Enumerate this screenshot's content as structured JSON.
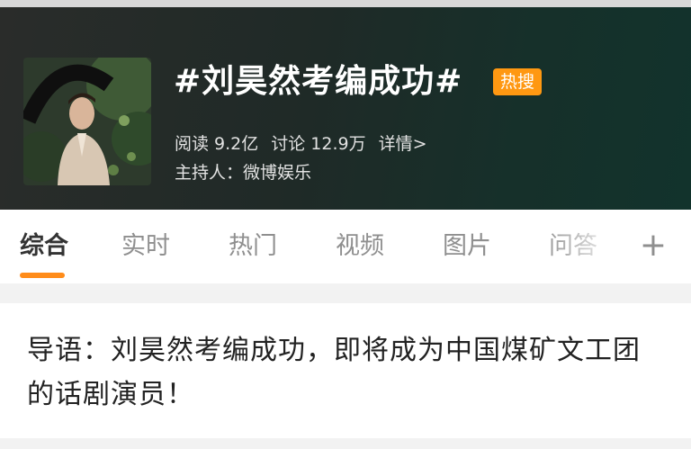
{
  "topic": {
    "title": "#刘昊然考编成功#",
    "badge": "热搜",
    "reads": "阅读 9.2亿",
    "discussions": "讨论 12.9万",
    "details_link": "详情>",
    "host": "主持人：微博娱乐"
  },
  "tabs": [
    {
      "label": "综合",
      "active": true
    },
    {
      "label": "实时",
      "active": false
    },
    {
      "label": "热门",
      "active": false
    },
    {
      "label": "视频",
      "active": false
    },
    {
      "label": "图片",
      "active": false
    },
    {
      "label": "问答",
      "active": false
    }
  ],
  "add_tab_label": "+",
  "guide_text": "导语：刘昊然考编成功，即将成为中国煤矿文工团的话剧演员！",
  "colors": {
    "badge": "#ff9812",
    "tab_indicator": "#ff8c1a"
  }
}
